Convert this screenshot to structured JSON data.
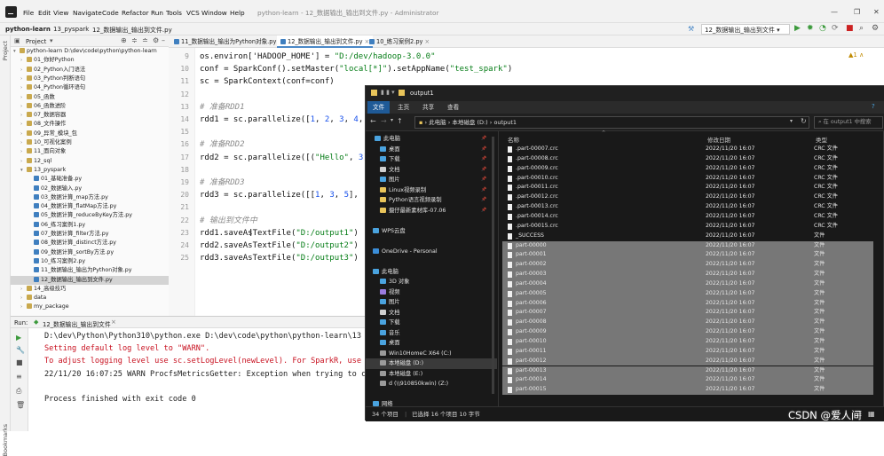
{
  "ide": {
    "menus": [
      "File",
      "Edit",
      "View",
      "Navigate",
      "Code",
      "Refactor",
      "Run",
      "Tools",
      "VCS",
      "Window",
      "Help"
    ],
    "window_title": "python-learn - 12_数据输出_输出到文件.py - Administrator",
    "breadcrumbs": [
      "python-learn",
      "13_pyspark",
      "12_数据输出_输出到文件.py"
    ],
    "run_config": "12_数据输出_输出到文件",
    "sidebar_strip": "Project",
    "bookmarks_strip": "Bookmarks",
    "project_panel_title": "Project",
    "tree": [
      {
        "label": "python-learn  D:\\dev\\code\\python\\python-learn",
        "depth": 0,
        "type": "root",
        "open": true
      },
      {
        "label": "01_你好Python",
        "depth": 1,
        "type": "folder"
      },
      {
        "label": "02_Python入门语法",
        "depth": 1,
        "type": "folder"
      },
      {
        "label": "03_Python判断语句",
        "depth": 1,
        "type": "folder"
      },
      {
        "label": "04_Python循环语句",
        "depth": 1,
        "type": "folder"
      },
      {
        "label": "05_函数",
        "depth": 1,
        "type": "folder"
      },
      {
        "label": "06_函数进阶",
        "depth": 1,
        "type": "folder"
      },
      {
        "label": "07_数据容器",
        "depth": 1,
        "type": "folder"
      },
      {
        "label": "08_文件操作",
        "depth": 1,
        "type": "folder"
      },
      {
        "label": "09_异常_模块_包",
        "depth": 1,
        "type": "folder"
      },
      {
        "label": "10_可视化案例",
        "depth": 1,
        "type": "folder"
      },
      {
        "label": "11_面向对象",
        "depth": 1,
        "type": "folder"
      },
      {
        "label": "12_sql",
        "depth": 1,
        "type": "folder"
      },
      {
        "label": "13_pyspark",
        "depth": 1,
        "type": "folder",
        "open": true
      },
      {
        "label": "01_基础准备.py",
        "depth": 2,
        "type": "py"
      },
      {
        "label": "02_数据输入.py",
        "depth": 2,
        "type": "py"
      },
      {
        "label": "03_数据计算_map方法.py",
        "depth": 2,
        "type": "py"
      },
      {
        "label": "04_数据计算_flatMap方法.py",
        "depth": 2,
        "type": "py"
      },
      {
        "label": "05_数据计算_reduceByKey方法.py",
        "depth": 2,
        "type": "py"
      },
      {
        "label": "06_练习案例1.py",
        "depth": 2,
        "type": "py"
      },
      {
        "label": "07_数据计算_filter方法.py",
        "depth": 2,
        "type": "py"
      },
      {
        "label": "08_数据计算_distinct方法.py",
        "depth": 2,
        "type": "py"
      },
      {
        "label": "09_数据计算_sortBy方法.py",
        "depth": 2,
        "type": "py"
      },
      {
        "label": "10_练习案例2.py",
        "depth": 2,
        "type": "py"
      },
      {
        "label": "11_数据输出_输出为Python对象.py",
        "depth": 2,
        "type": "py"
      },
      {
        "label": "12_数据输出_输出到文件.py",
        "depth": 2,
        "type": "py",
        "selected": true
      },
      {
        "label": "14_高级技巧",
        "depth": 1,
        "type": "folder"
      },
      {
        "label": "data",
        "depth": 1,
        "type": "folder"
      },
      {
        "label": "my_package",
        "depth": 1,
        "type": "folder"
      }
    ],
    "editor_tabs": [
      {
        "label": "11_数据输出_输出为Python对象.py",
        "active": false
      },
      {
        "label": "12_数据输出_输出到文件.py",
        "active": true
      },
      {
        "label": "10_练习案例2.py",
        "active": false
      }
    ],
    "warning_count": "1",
    "code_lines": [
      {
        "n": "9",
        "html": "os.environ['HADOOP_HOME'] = <span class=\"st\">\"D:/dev/hadoop-3.0.0\"</span>"
      },
      {
        "n": "10",
        "html": "conf = SparkConf().setMaster(<span class=\"st\">\"local[*]\"</span>).setAppName(<span class=\"st\">\"test_spark\"</span>)"
      },
      {
        "n": "11",
        "html": "sc = SparkContext(conf=conf)"
      },
      {
        "n": "12",
        "html": ""
      },
      {
        "n": "13",
        "html": "<span class=\"cm\"># 准备RDD1</span>"
      },
      {
        "n": "14",
        "html": "rdd1 = sc.parallelize([<span class=\"nu\">1</span>, <span class=\"nu\">2</span>, <span class=\"nu\">3</span>, <span class=\"nu\">4</span>, <span class=\"nu\">5</span>"
      },
      {
        "n": "15",
        "html": ""
      },
      {
        "n": "16",
        "html": "<span class=\"cm\"># 准备RDD2</span>"
      },
      {
        "n": "17",
        "html": "rdd2 = sc.parallelize([(<span class=\"st\">\"Hello\"</span>, <span class=\"nu\">3</span>),"
      },
      {
        "n": "18",
        "html": ""
      },
      {
        "n": "19",
        "html": "<span class=\"cm\"># 准备RDD3</span>"
      },
      {
        "n": "20",
        "html": "rdd3 = sc.parallelize([[<span class=\"nu\">1</span>, <span class=\"nu\">3</span>, <span class=\"nu\">5</span>], [<span class=\"nu\">4</span>"
      },
      {
        "n": "21",
        "html": ""
      },
      {
        "n": "22",
        "html": "<span class=\"cm\"># 输出到文件中</span>"
      },
      {
        "n": "23",
        "html": "rdd1.saveAsTextFile(<span class=\"st\">\"D:/output1\"</span>)"
      },
      {
        "n": "24",
        "html": "rdd2.saveAsTextFile(<span class=\"st\">\"D:/output2\"</span>)"
      },
      {
        "n": "25",
        "html": "rdd3.saveAsTextFile(<span class=\"st\">\"D:/output3\"</span>)"
      }
    ],
    "run_label": "Run:",
    "run_tab": "12_数据输出_输出到文件",
    "console": [
      {
        "text": "D:\\dev\\Python\\Python310\\python.exe D:\\dev\\code\\python\\python-learn\\13",
        "cls": ""
      },
      {
        "text": "Setting default log level to \"WARN\".",
        "cls": "red"
      },
      {
        "text": "To adjust logging level use sc.setLogLevel(newLevel). For SparkR, use",
        "cls": "red"
      },
      {
        "text": "22/11/20 16:07:25 WARN ProcfsMetricsGetter: Exception when trying to c",
        "cls": ""
      },
      {
        "text": "",
        "cls": ""
      },
      {
        "text": "Process finished with exit code 0",
        "cls": ""
      }
    ]
  },
  "explorer": {
    "title": "output1",
    "ribbon_tabs": [
      "文件",
      "主页",
      "共享",
      "查看"
    ],
    "address": [
      "此电脑",
      "本地磁盘 (D:)",
      "output1"
    ],
    "search_placeholder": "在 output1 中搜索",
    "nav_items": [
      {
        "label": "此电脑",
        "pin": true,
        "icon": "#4aa3df"
      },
      {
        "label": "桌面",
        "pin": true,
        "icon": "#4aa3df"
      },
      {
        "label": "下载",
        "pin": true,
        "icon": "#4aa3df"
      },
      {
        "label": "文档",
        "pin": true,
        "icon": "#cfcfcf"
      },
      {
        "label": "图片",
        "pin": true,
        "icon": "#4aa3df"
      },
      {
        "label": "Linux视频录制",
        "pin": true,
        "icon": "#e8c45a"
      },
      {
        "label": "Python语言视频录制",
        "pin": true,
        "icon": "#e8c45a"
      },
      {
        "label": "摄仔最新素材库-07.06",
        "pin": true,
        "icon": "#e8c45a"
      },
      {
        "label": "",
        "pin": false,
        "icon": ""
      },
      {
        "label": "WPS云盘",
        "pin": false,
        "icon": "#4aa3df"
      },
      {
        "label": "",
        "pin": false,
        "icon": ""
      },
      {
        "label": "OneDrive - Personal",
        "pin": false,
        "icon": "#3b8ed8"
      },
      {
        "label": "",
        "pin": false,
        "icon": ""
      },
      {
        "label": "此电脑",
        "pin": false,
        "icon": "#4aa3df"
      },
      {
        "label": "3D 对象",
        "pin": false,
        "icon": "#4aa3df"
      },
      {
        "label": "视频",
        "pin": false,
        "icon": "#9a7be0"
      },
      {
        "label": "图片",
        "pin": false,
        "icon": "#4aa3df"
      },
      {
        "label": "文档",
        "pin": false,
        "icon": "#cfcfcf"
      },
      {
        "label": "下载",
        "pin": false,
        "icon": "#4aa3df"
      },
      {
        "label": "音乐",
        "pin": false,
        "icon": "#4aa3df"
      },
      {
        "label": "桌面",
        "pin": false,
        "icon": "#4aa3df"
      },
      {
        "label": "Win10HomeC X64 (C:)",
        "pin": false,
        "icon": "#9a9a9a"
      },
      {
        "label": "本地磁盘 (D:)",
        "pin": false,
        "icon": "#9a9a9a",
        "selected": true
      },
      {
        "label": "本地磁盘 (E:)",
        "pin": false,
        "icon": "#9a9a9a"
      },
      {
        "label": "d (\\\\910850kwin) (Z:)",
        "pin": false,
        "icon": "#9a9a9a"
      },
      {
        "label": "",
        "pin": false,
        "icon": ""
      },
      {
        "label": "网络",
        "pin": false,
        "icon": "#4aa3df"
      }
    ],
    "columns": {
      "name": "名称",
      "date": "修改日期",
      "type": "类型"
    },
    "files": [
      {
        "name": ".part-00007.crc",
        "date": "2022/11/20 16:07",
        "type": "CRC 文件",
        "sel": false
      },
      {
        "name": ".part-00008.crc",
        "date": "2022/11/20 16:07",
        "type": "CRC 文件",
        "sel": false
      },
      {
        "name": ".part-00009.crc",
        "date": "2022/11/20 16:07",
        "type": "CRC 文件",
        "sel": false
      },
      {
        "name": ".part-00010.crc",
        "date": "2022/11/20 16:07",
        "type": "CRC 文件",
        "sel": false
      },
      {
        "name": ".part-00011.crc",
        "date": "2022/11/20 16:07",
        "type": "CRC 文件",
        "sel": false
      },
      {
        "name": ".part-00012.crc",
        "date": "2022/11/20 16:07",
        "type": "CRC 文件",
        "sel": false
      },
      {
        "name": ".part-00013.crc",
        "date": "2022/11/20 16:07",
        "type": "CRC 文件",
        "sel": false
      },
      {
        "name": ".part-00014.crc",
        "date": "2022/11/20 16:07",
        "type": "CRC 文件",
        "sel": false
      },
      {
        "name": ".part-00015.crc",
        "date": "2022/11/20 16:07",
        "type": "CRC 文件",
        "sel": false
      },
      {
        "name": "_SUCCESS",
        "date": "2022/11/20 16:07",
        "type": "文件",
        "sel": false
      },
      {
        "name": "part-00000",
        "date": "2022/11/20 16:07",
        "type": "文件",
        "sel": true
      },
      {
        "name": "part-00001",
        "date": "2022/11/20 16:07",
        "type": "文件",
        "sel": true
      },
      {
        "name": "part-00002",
        "date": "2022/11/20 16:07",
        "type": "文件",
        "sel": true
      },
      {
        "name": "part-00003",
        "date": "2022/11/20 16:07",
        "type": "文件",
        "sel": true
      },
      {
        "name": "part-00004",
        "date": "2022/11/20 16:07",
        "type": "文件",
        "sel": true
      },
      {
        "name": "part-00005",
        "date": "2022/11/20 16:07",
        "type": "文件",
        "sel": true
      },
      {
        "name": "part-00006",
        "date": "2022/11/20 16:07",
        "type": "文件",
        "sel": true
      },
      {
        "name": "part-00007",
        "date": "2022/11/20 16:07",
        "type": "文件",
        "sel": true
      },
      {
        "name": "part-00008",
        "date": "2022/11/20 16:07",
        "type": "文件",
        "sel": true
      },
      {
        "name": "part-00009",
        "date": "2022/11/20 16:07",
        "type": "文件",
        "sel": true
      },
      {
        "name": "part-00010",
        "date": "2022/11/20 16:07",
        "type": "文件",
        "sel": true
      },
      {
        "name": "part-00011",
        "date": "2022/11/20 16:07",
        "type": "文件",
        "sel": true
      },
      {
        "name": "part-00012",
        "date": "2022/11/20 16:07",
        "type": "文件",
        "sel": true
      },
      {
        "name": "part-00013",
        "date": "2022/11/20 16:07",
        "type": "文件",
        "sel": true
      },
      {
        "name": "part-00014",
        "date": "2022/11/20 16:07",
        "type": "文件",
        "sel": true
      },
      {
        "name": "part-00015",
        "date": "2022/11/20 16:07",
        "type": "文件",
        "sel": true
      }
    ],
    "status_items": "34 个项目",
    "status_selected": "已选择 16 个项目  10 字节"
  },
  "watermark": "CSDN @爱人间",
  "colors": {
    "accent": "#4a88c7",
    "explorer_bg": "#191919",
    "ribbon_active": "#1f5a97"
  }
}
